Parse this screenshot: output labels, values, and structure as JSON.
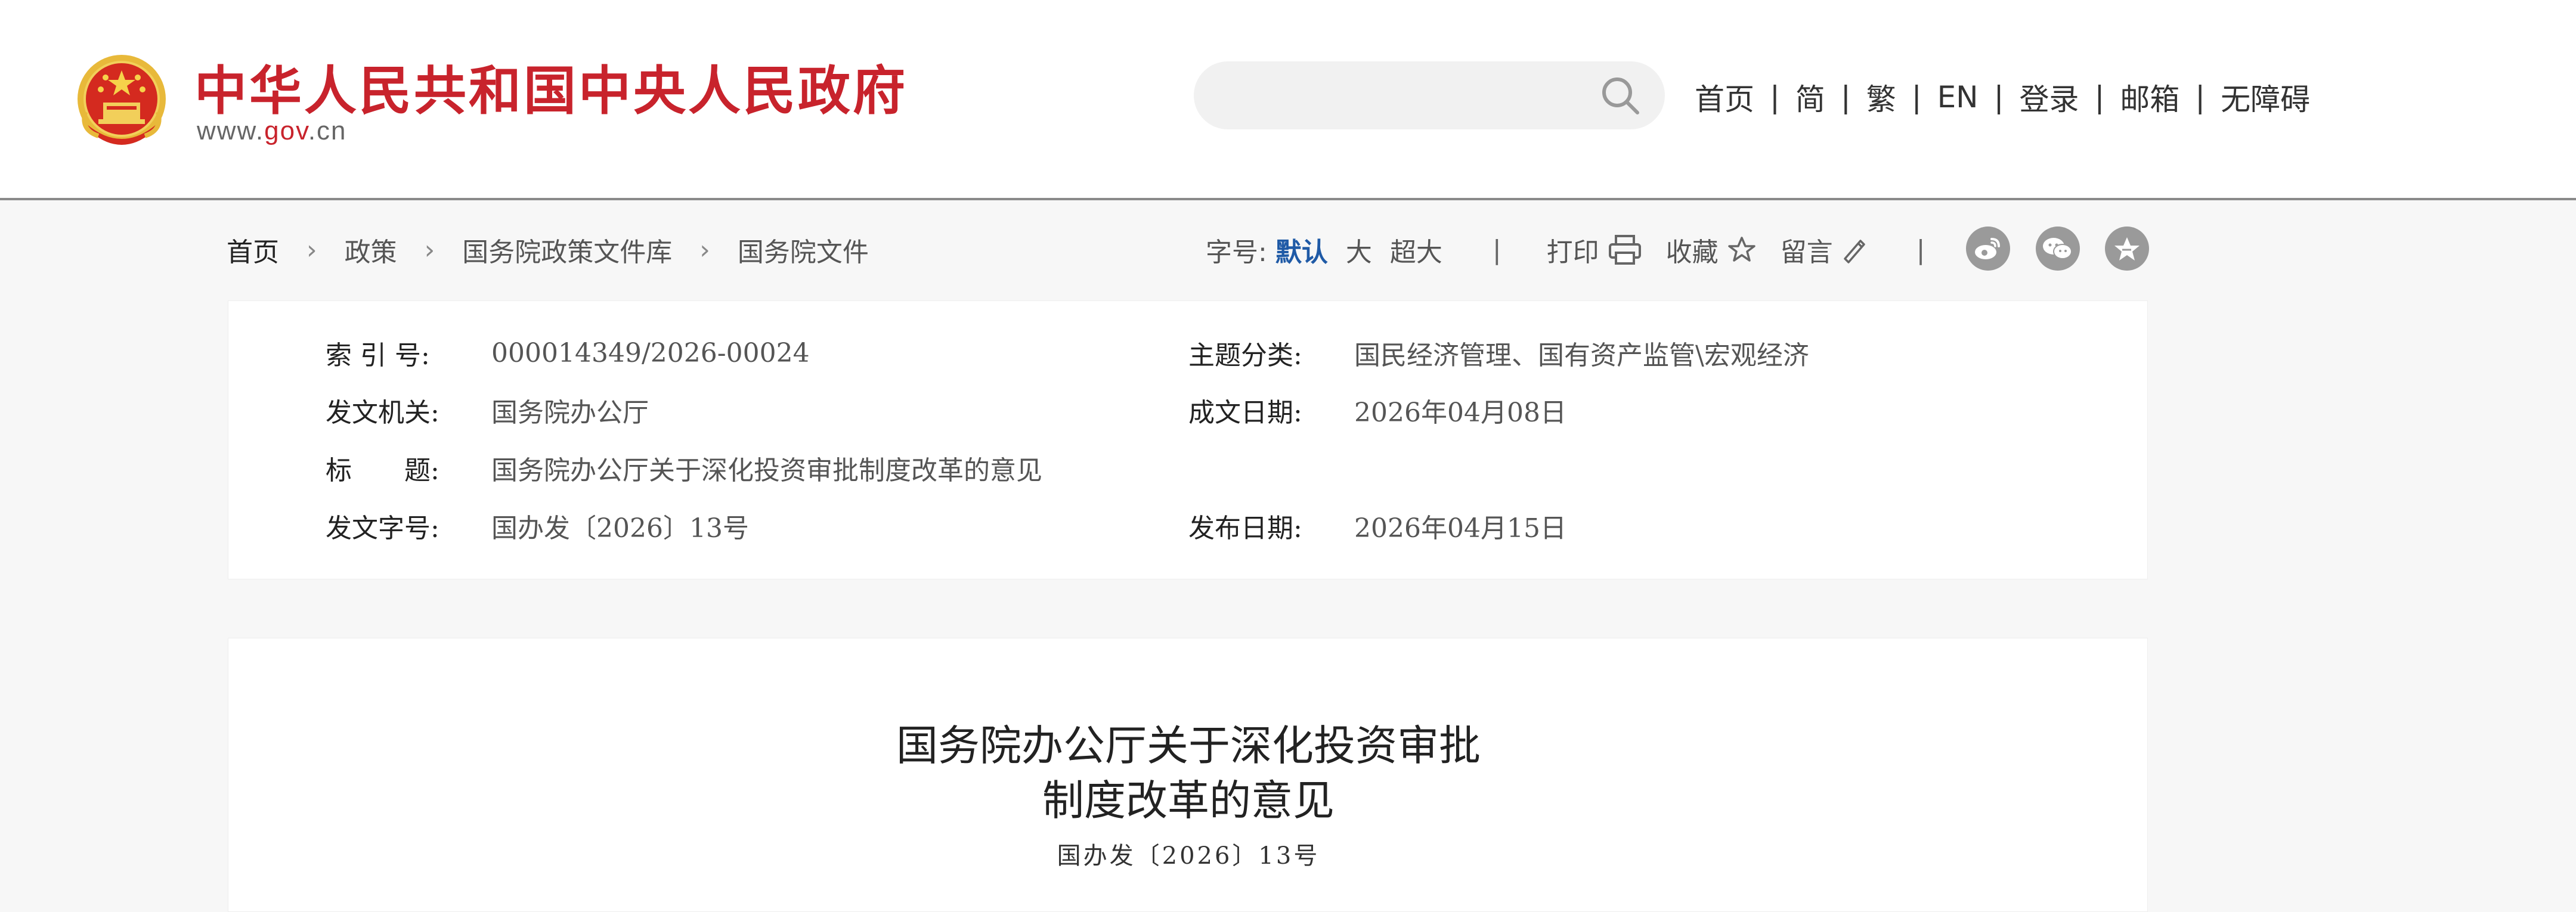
{
  "header": {
    "site_title": "中华人民共和国中央人民政府",
    "domain_prefix": "www.",
    "domain_gov": "gov",
    "domain_suffix": ".cn",
    "search_placeholder": "",
    "nav": [
      "首页",
      "简",
      "繁",
      "EN",
      "登录",
      "邮箱",
      "无障碍"
    ],
    "nav_separator": "|",
    "brand_color": "#c8232c"
  },
  "breadcrumb": {
    "items": [
      "首页",
      "政策",
      "国务院政策文件库",
      "国务院文件"
    ],
    "separator": "›"
  },
  "tools": {
    "font_size_label": "字号:",
    "font_default": "默认",
    "font_large": "大",
    "font_xl": "超大",
    "bar": "|",
    "print": "打印",
    "favorite": "收藏",
    "comment": "留言",
    "bar2": "|",
    "share_icons": [
      "weibo-icon",
      "wechat-icon",
      "qzone-icon"
    ],
    "accent_color": "#1f5aa6"
  },
  "meta": {
    "index_label": "索 引 号:",
    "index_value": "000014349/2026-00024",
    "category_label": "主题分类:",
    "category_value": "国民经济管理、国有资产监管\\宏观经济",
    "issuer_label": "发文机关:",
    "issuer_value": "国务院办公厅",
    "date_written_label": "成文日期:",
    "date_written_value": "2026年04月08日",
    "title_label": "标　　题:",
    "title_value": "国务院办公厅关于深化投资审批制度改革的意见",
    "doc_no_label": "发文字号:",
    "doc_no_value": "国办发〔2026〕13号",
    "publish_label": "发布日期:",
    "publish_value": "2026年04月15日"
  },
  "article": {
    "title_line1": "国务院办公厅关于深化投资审批",
    "title_line2": "制度改革的意见",
    "doc_no": "国办发〔2026〕13号"
  }
}
